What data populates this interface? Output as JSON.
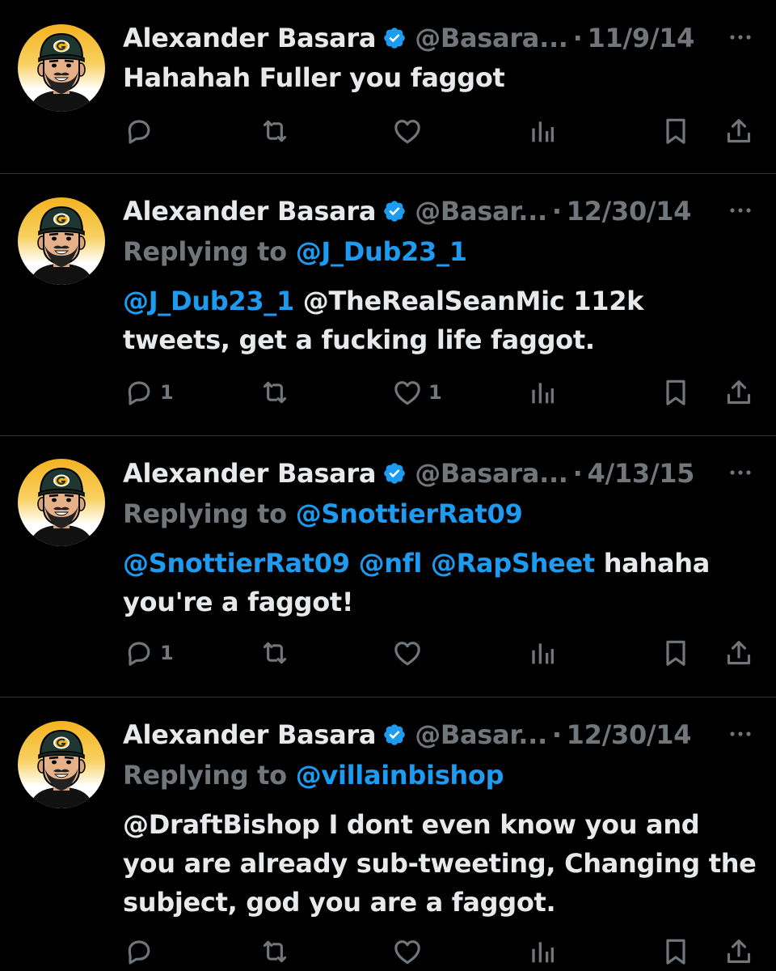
{
  "tweets": [
    {
      "name": "Alexander Basara",
      "handle": "@Basara...",
      "dot": "·",
      "date": "11/9/14",
      "replying_prefix": "",
      "replying_to": "",
      "text_mentions": "",
      "text": "Hahahah Fuller you faggot",
      "reply_count": "",
      "like_count": ""
    },
    {
      "name": "Alexander Basara",
      "handle": "@Basar...",
      "dot": "·",
      "date": "12/30/14",
      "replying_prefix": "Replying to ",
      "replying_to": "@J_Dub23_1",
      "text_mentions": "@J_Dub23_1",
      "text": " @TheRealSeanMic 112k tweets, get a fucking life faggot.",
      "reply_count": "1",
      "like_count": "1"
    },
    {
      "name": "Alexander Basara",
      "handle": "@Basara...",
      "dot": "·",
      "date": "4/13/15",
      "replying_prefix": "Replying to ",
      "replying_to": "@SnottierRat09",
      "text_mentions": "@SnottierRat09 @nfl @RapSheet",
      "text": " hahaha you're a faggot!",
      "reply_count": "1",
      "like_count": ""
    },
    {
      "name": "Alexander Basara",
      "handle": "@Basar...",
      "dot": "·",
      "date": "12/30/14",
      "replying_prefix": "Replying to ",
      "replying_to": "@villainbishop",
      "text_mentions": "",
      "text": "@DraftBishop I dont even know you and you are already sub-tweeting, Changing the subject, god you are a faggot.",
      "reply_count": "",
      "like_count": ""
    }
  ],
  "icons": {
    "reply": "reply-icon",
    "retweet": "retweet-icon",
    "like": "heart-icon",
    "views": "views-icon",
    "bookmark": "bookmark-icon",
    "share": "share-icon",
    "more": "more-icon",
    "verified": "verified-badge-icon"
  },
  "colors": {
    "background": "#000000",
    "text": "#e7e9ea",
    "muted": "#71767b",
    "link": "#1d9bf0",
    "verified": "#1d9bf0",
    "divider": "#2f3336"
  }
}
